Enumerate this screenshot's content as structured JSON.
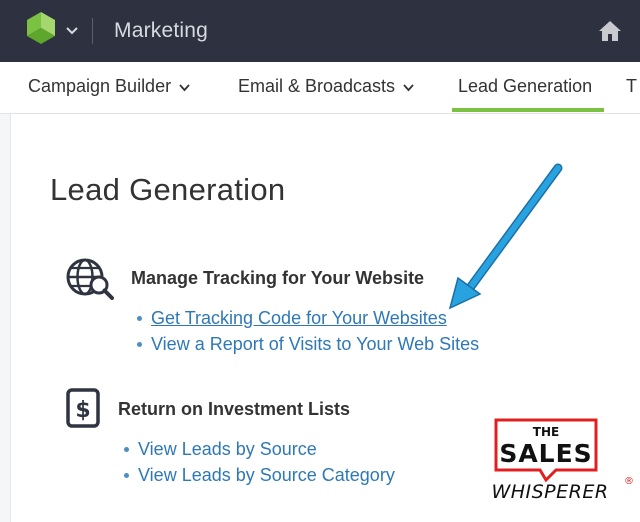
{
  "app": {
    "title": "Marketing"
  },
  "nav": {
    "tabs": [
      {
        "label": "Campaign Builder"
      },
      {
        "label": "Email & Broadcasts"
      },
      {
        "label": "Lead Generation"
      }
    ],
    "partial_tab": "T"
  },
  "page": {
    "title": "Lead Generation"
  },
  "sections": {
    "tracking": {
      "heading": "Manage Tracking for Your Website",
      "links": [
        {
          "label": "Get Tracking Code for Your Websites"
        },
        {
          "label": "View a Report of Visits to Your Web Sites"
        }
      ]
    },
    "roi": {
      "heading": "Return on Investment Lists",
      "links": [
        {
          "label": "View Leads by Source"
        },
        {
          "label": "View Leads by Source Category"
        }
      ]
    }
  },
  "watermark": {
    "line1": "THE",
    "line2": "SALES",
    "line3": "WHISPERER",
    "mark": "®"
  },
  "colors": {
    "topbar": "#2d3140",
    "accent_green": "#7cc242",
    "link_blue": "#2e78b7",
    "arrow_blue": "#29a3e0",
    "watermark_red": "#e02020"
  },
  "icons": {
    "logo": "keap-logo-icon",
    "app_switch": "chevron-down-icon",
    "home": "home-icon",
    "tracking": "globe-search-icon",
    "roi": "dollar-document-icon"
  }
}
